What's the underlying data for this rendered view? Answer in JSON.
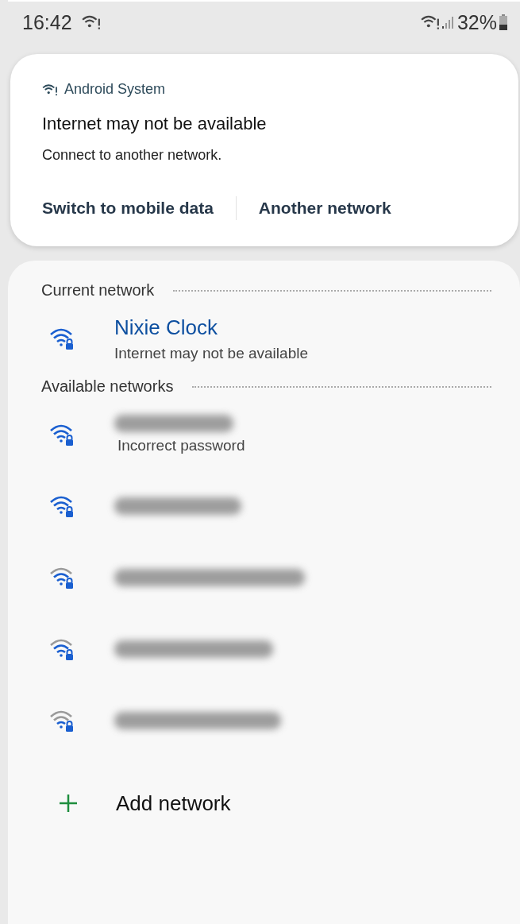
{
  "status_bar": {
    "time": "16:42",
    "battery": "32%"
  },
  "notification": {
    "app": "Android System",
    "title": "Internet may not be available",
    "body": "Connect to another network.",
    "actions": [
      "Switch to mobile data",
      "Another network"
    ]
  },
  "current_network": {
    "heading": "Current network",
    "name": "Nixie Clock",
    "status": "Internet may not be available",
    "kind": "full"
  },
  "available_networks": {
    "heading": "Available networks",
    "items": [
      {
        "status": "Incorrect password",
        "kind": "full"
      },
      {
        "kind": "full"
      },
      {
        "kind": "good"
      },
      {
        "kind": "good"
      },
      {
        "kind": "fair"
      }
    ]
  },
  "add_network": {
    "label": "Add network"
  }
}
